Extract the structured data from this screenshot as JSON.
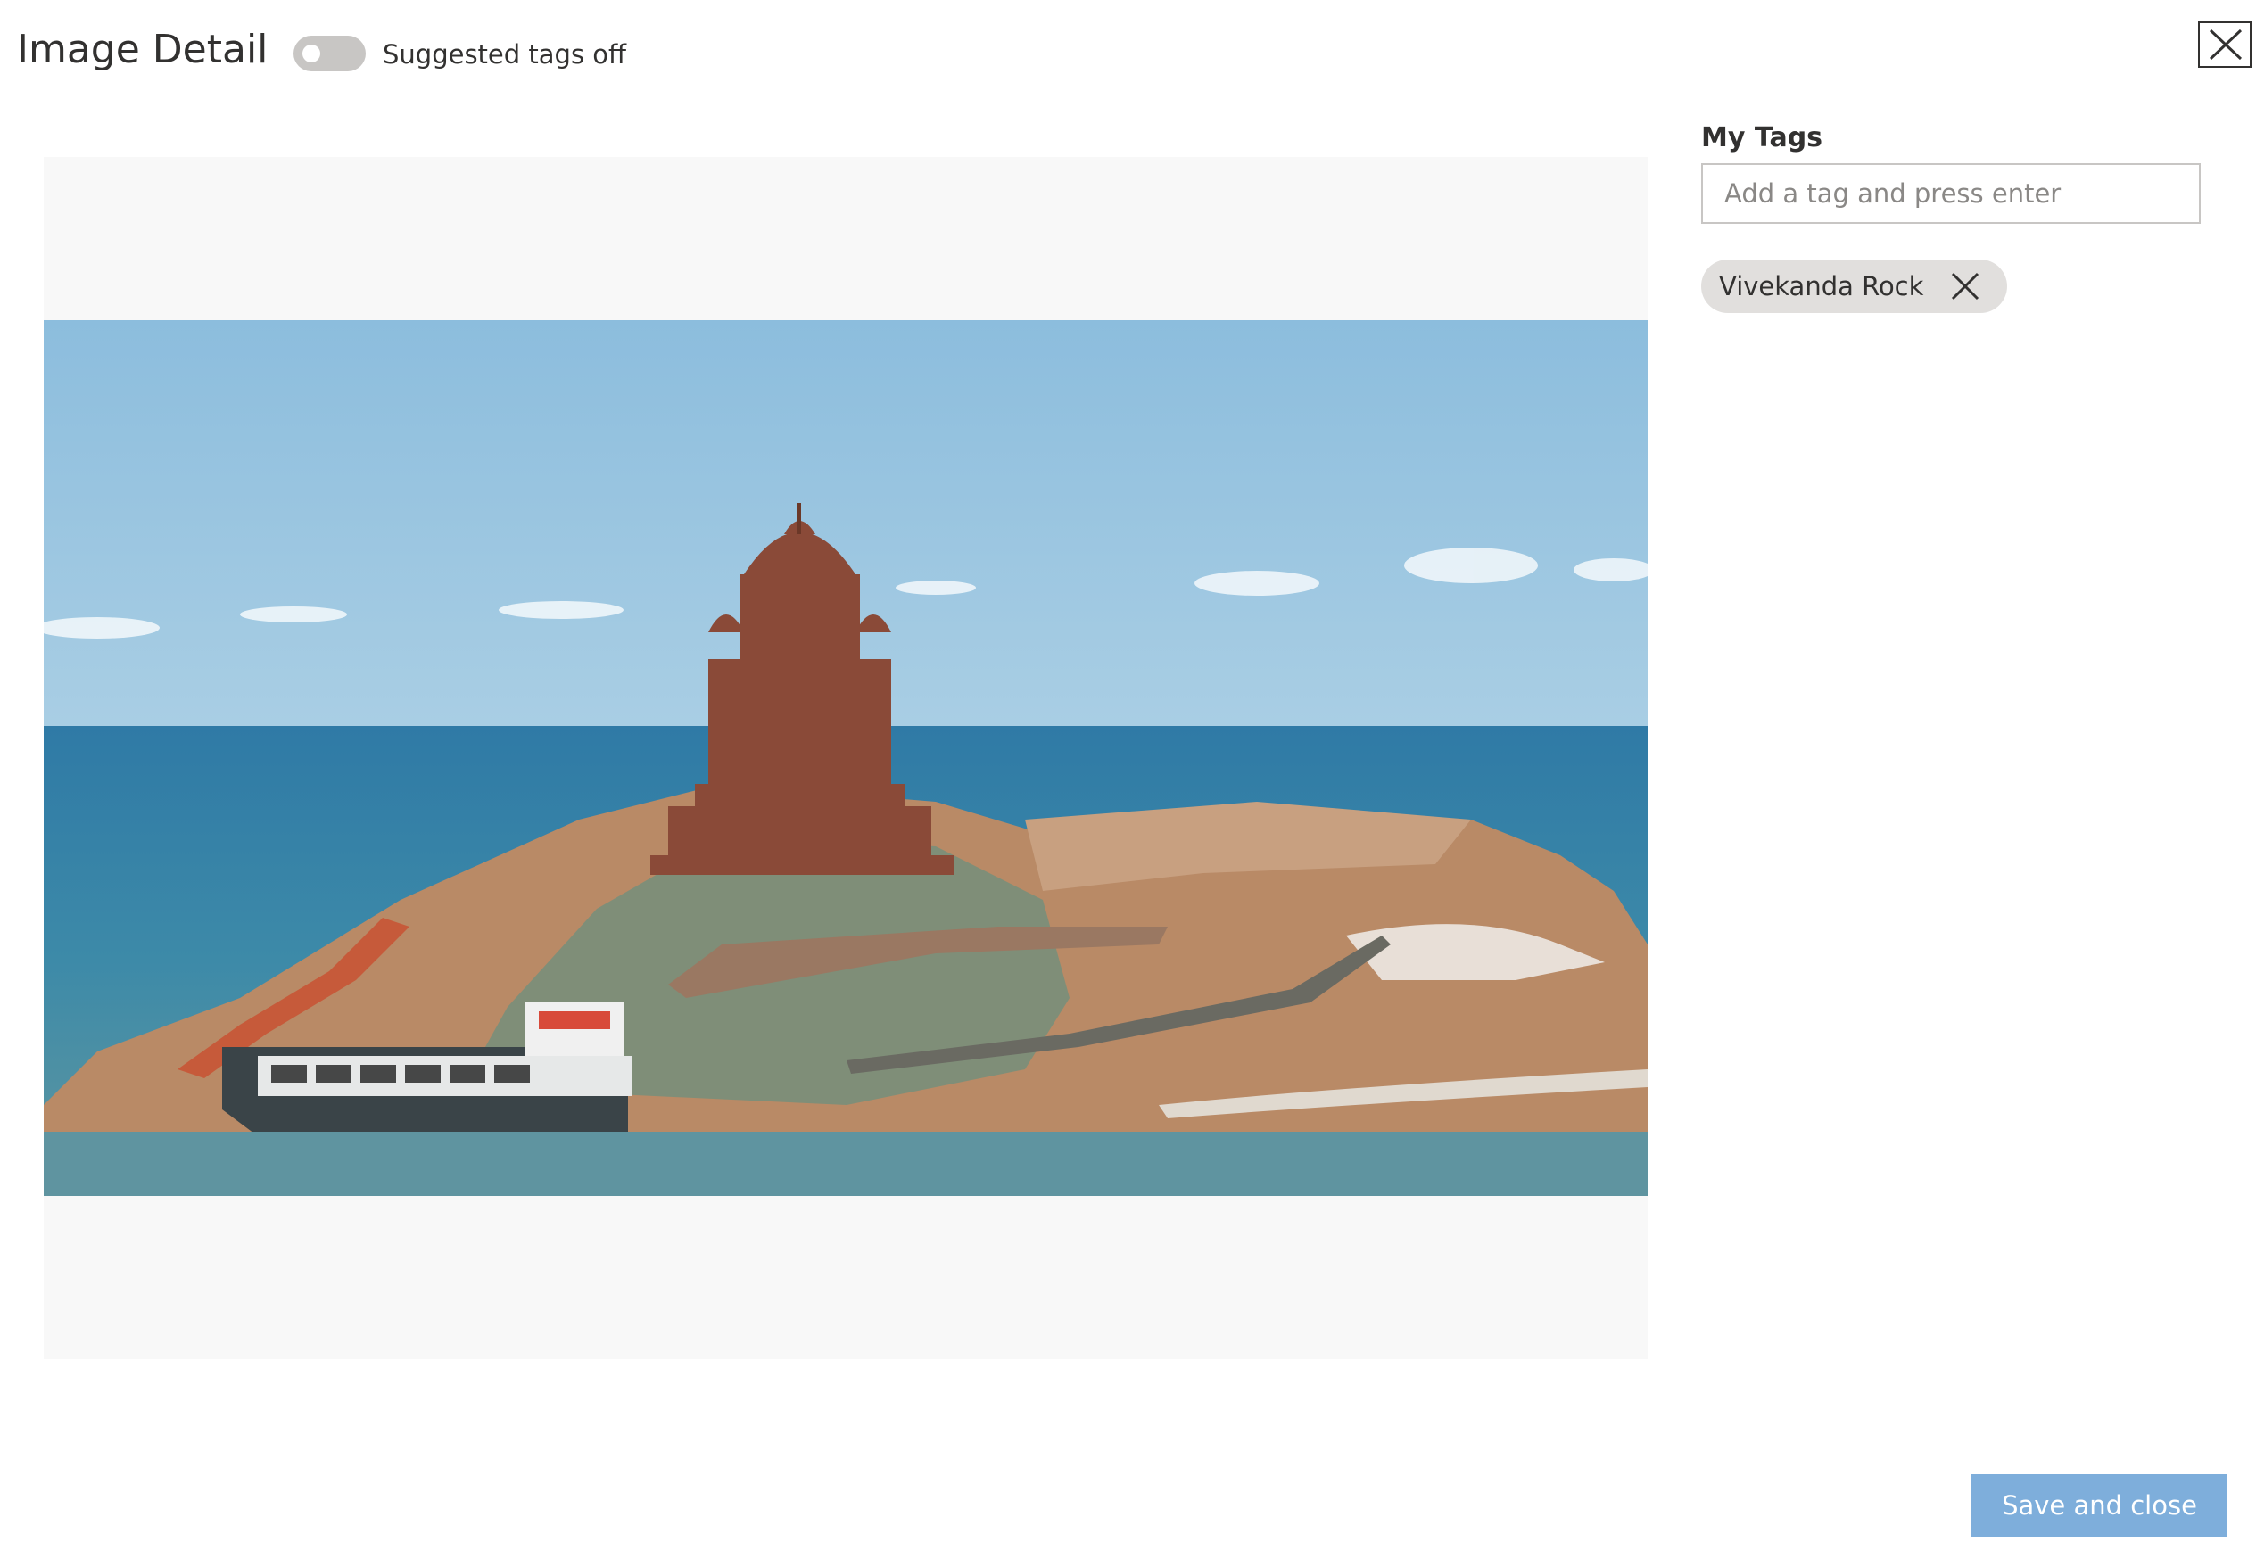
{
  "header": {
    "title": "Image Detail",
    "suggested_tags_label": "Suggested tags off",
    "suggested_tags_enabled": false,
    "close_icon": "close-icon"
  },
  "image": {
    "subject": "Vivekananda Rock Memorial on a rocky island in the sea"
  },
  "tags_panel": {
    "label": "My Tags",
    "input_placeholder": "Add a tag and press enter",
    "input_value": "",
    "tags": [
      {
        "label": "Vivekanda Rock",
        "remove_icon": "close-icon"
      }
    ]
  },
  "footer": {
    "save_label": "Save and close"
  },
  "colors": {
    "primary_disabled": "#7eaedb",
    "chip_background": "#e1dfdd",
    "toggle_off": "#c8c6c4",
    "image_letterbox": "#f8f8f8"
  }
}
